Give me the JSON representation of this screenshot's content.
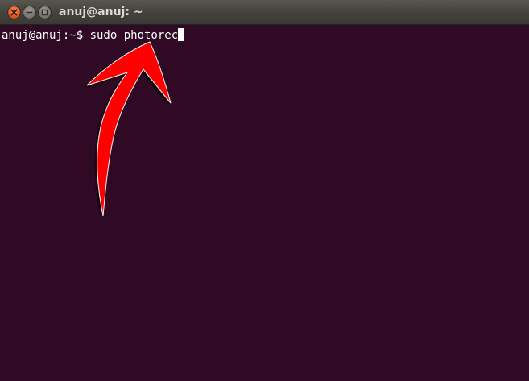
{
  "window": {
    "title": "anuj@anuj: ~",
    "close_icon": "close-icon",
    "minimize_icon": "minimize-icon",
    "maximize_icon": "maximize-icon"
  },
  "terminal": {
    "prompt": "anuj@anuj:~$ ",
    "command": "sudo photorec",
    "background_color": "#300a24",
    "text_color": "#ffffff"
  },
  "annotation": {
    "icon": "red-arrow-icon",
    "color": "#ff0000"
  }
}
